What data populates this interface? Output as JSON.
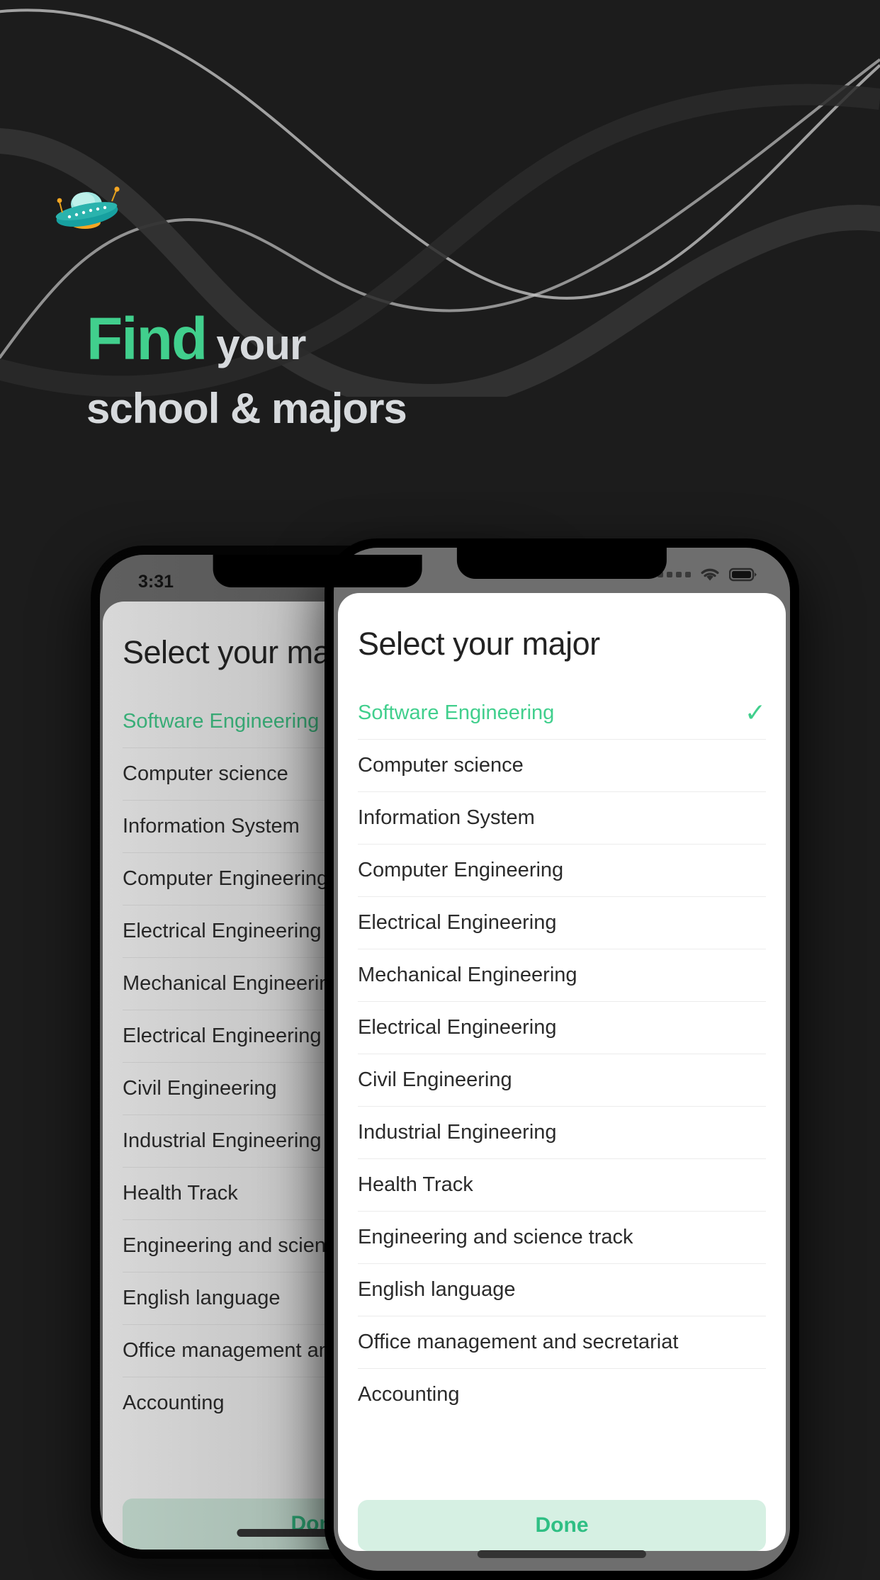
{
  "hero": {
    "headline_word_accent": "Find",
    "headline_word_rest": "your",
    "headline_line2": "school & majors",
    "accent_color": "#41cf8d",
    "text_color": "#d7dadd",
    "background_color": "#1c1c1c",
    "illustration_name": "ufo-illustration"
  },
  "status_bar": {
    "time": "3:31",
    "signal_icon": "signal-dots-icon",
    "wifi_icon": "wifi-icon",
    "battery_icon": "battery-icon"
  },
  "screen": {
    "title": "Select your major",
    "majors": [
      {
        "label": "Software Engineering",
        "selected": true
      },
      {
        "label": "Computer science",
        "selected": false
      },
      {
        "label": "Information System",
        "selected": false
      },
      {
        "label": "Computer Engineering",
        "selected": false
      },
      {
        "label": "Electrical Engineering",
        "selected": false
      },
      {
        "label": "Mechanical Engineering",
        "selected": false
      },
      {
        "label": "Electrical Engineering",
        "selected": false
      },
      {
        "label": "Civil Engineering",
        "selected": false
      },
      {
        "label": "Industrial Engineering",
        "selected": false
      },
      {
        "label": "Health Track",
        "selected": false
      },
      {
        "label": "Engineering and science track",
        "selected": false
      },
      {
        "label": "English language",
        "selected": false
      },
      {
        "label": "Office management and secretariat",
        "selected": false
      },
      {
        "label": "Accounting",
        "selected": false
      }
    ],
    "check_glyph": "✓",
    "done_label": "Done",
    "done_bg_color": "#d6f0e3",
    "done_text_color": "#2fbf84"
  }
}
